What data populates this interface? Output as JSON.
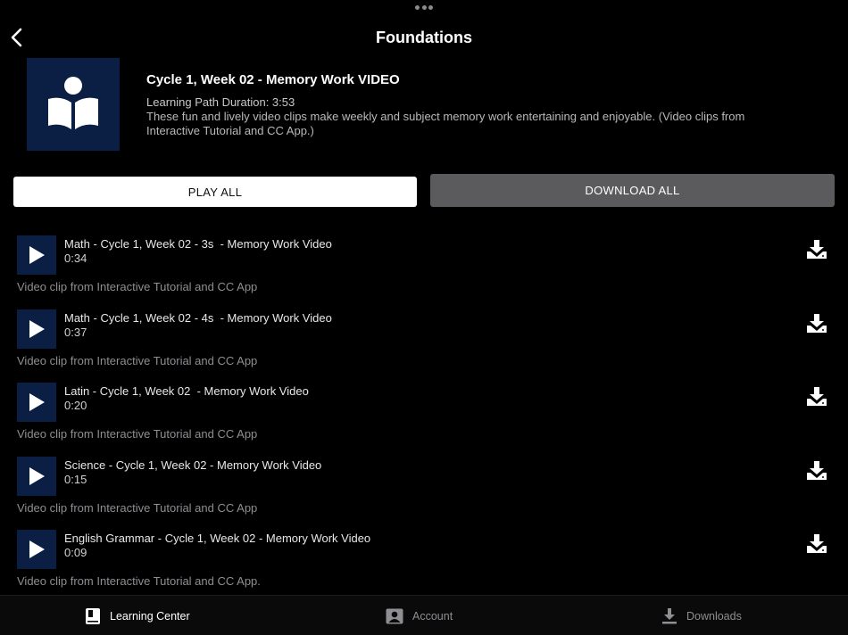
{
  "header": {
    "title": "Foundations"
  },
  "hero": {
    "title": "Cycle 1, Week 02 - Memory Work VIDEO",
    "duration": "Learning Path Duration: 3:53",
    "description": "These fun and lively video clips make weekly and subject memory work entertaining and enjoyable. (Video clips from Interactive Tutorial and CC App.)"
  },
  "actions": {
    "play_all": "PLAY ALL",
    "download_all": "DOWNLOAD ALL"
  },
  "items": [
    {
      "title": "Math - Cycle 1, Week 02 - 3s  - Memory Work Video",
      "duration": "0:34",
      "description": "Video clip from Interactive Tutorial and CC App"
    },
    {
      "title": "Math - Cycle 1, Week 02 - 4s  - Memory Work Video",
      "duration": "0:37",
      "description": "Video clip from Interactive Tutorial and CC App"
    },
    {
      "title": "Latin - Cycle 1, Week 02  - Memory Work Video",
      "duration": "0:20",
      "description": "Video clip from Interactive Tutorial and CC App"
    },
    {
      "title": "Science - Cycle 1, Week 02 - Memory Work Video",
      "duration": "0:15",
      "description": "Video clip from Interactive Tutorial and CC App"
    },
    {
      "title": "English Grammar - Cycle 1, Week 02 - Memory Work Video",
      "duration": "0:09",
      "description": "Video clip from Interactive Tutorial and CC App."
    }
  ],
  "tabs": [
    {
      "label": "Learning Center",
      "icon": "book-icon",
      "active": true
    },
    {
      "label": "Account",
      "icon": "account-icon",
      "active": false
    },
    {
      "label": "Downloads",
      "icon": "download-icon",
      "active": false
    }
  ],
  "colors": {
    "thumb_bg": "#0b1f44",
    "background": "#000000",
    "download_all_bg": "#5b5b5d"
  }
}
